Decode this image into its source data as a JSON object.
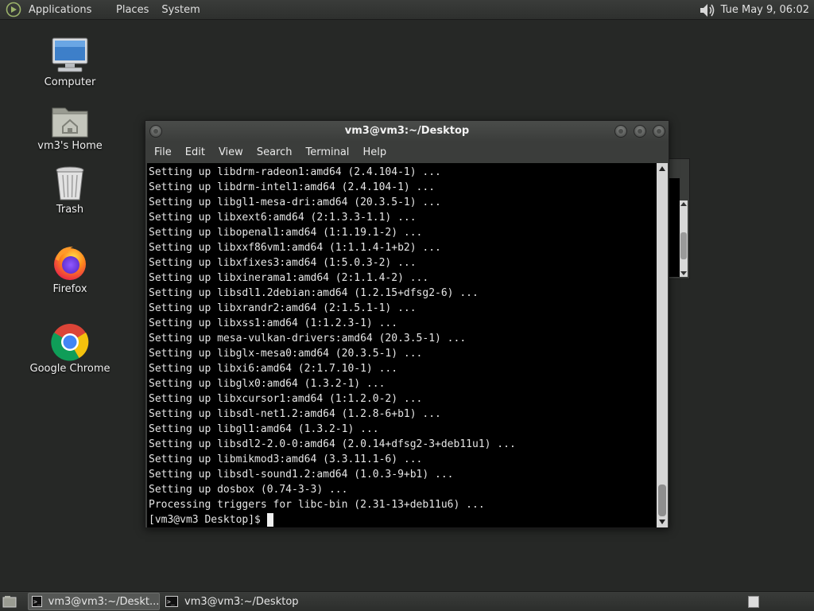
{
  "top_panel": {
    "menus": [
      "Applications",
      "Places",
      "System"
    ],
    "volume_icon": "speaker-icon",
    "clock": "Tue May  9, 06:02"
  },
  "desktop": {
    "icons": [
      {
        "label": "Computer",
        "icon": "computer-icon"
      },
      {
        "label": "vm3's Home",
        "icon": "home-folder-icon"
      },
      {
        "label": "Trash",
        "icon": "trash-icon"
      },
      {
        "label": "Firefox",
        "icon": "firefox-icon"
      },
      {
        "label": "Google Chrome",
        "icon": "chrome-icon"
      }
    ]
  },
  "terminal": {
    "title": "vm3@vm3:~/Desktop",
    "menu": [
      "File",
      "Edit",
      "View",
      "Search",
      "Terminal",
      "Help"
    ],
    "lines": [
      "Setting up libdrm-radeon1:amd64 (2.4.104-1) ...",
      "Setting up libdrm-intel1:amd64 (2.4.104-1) ...",
      "Setting up libgl1-mesa-dri:amd64 (20.3.5-1) ...",
      "Setting up libxext6:amd64 (2:1.3.3-1.1) ...",
      "Setting up libopenal1:amd64 (1:1.19.1-2) ...",
      "Setting up libxxf86vm1:amd64 (1:1.1.4-1+b2) ...",
      "Setting up libxfixes3:amd64 (1:5.0.3-2) ...",
      "Setting up libxinerama1:amd64 (2:1.1.4-2) ...",
      "Setting up libsdl1.2debian:amd64 (1.2.15+dfsg2-6) ...",
      "Setting up libxrandr2:amd64 (2:1.5.1-1) ...",
      "Setting up libxss1:amd64 (1:1.2.3-1) ...",
      "Setting up mesa-vulkan-drivers:amd64 (20.3.5-1) ...",
      "Setting up libglx-mesa0:amd64 (20.3.5-1) ...",
      "Setting up libxi6:amd64 (2:1.7.10-1) ...",
      "Setting up libglx0:amd64 (1.3.2-1) ...",
      "Setting up libxcursor1:amd64 (1:1.2.0-2) ...",
      "Setting up libsdl-net1.2:amd64 (1.2.8-6+b1) ...",
      "Setting up libgl1:amd64 (1.3.2-1) ...",
      "Setting up libsdl2-2.0-0:amd64 (2.0.14+dfsg2-3+deb11u1) ...",
      "Setting up libmikmod3:amd64 (3.3.11.1-6) ...",
      "Setting up libsdl-sound1.2:amd64 (1.0.3-9+b1) ...",
      "Setting up dosbox (0.74-3-3) ...",
      "Processing triggers for libc-bin (2.31-13+deb11u6) ..."
    ],
    "prompt": "[vm3@vm3 Desktop]$"
  },
  "taskbar": {
    "tasks": [
      {
        "label": "vm3@vm3:~/Deskt...",
        "active": true
      },
      {
        "label": "vm3@vm3:~/Desktop",
        "active": false
      }
    ]
  }
}
